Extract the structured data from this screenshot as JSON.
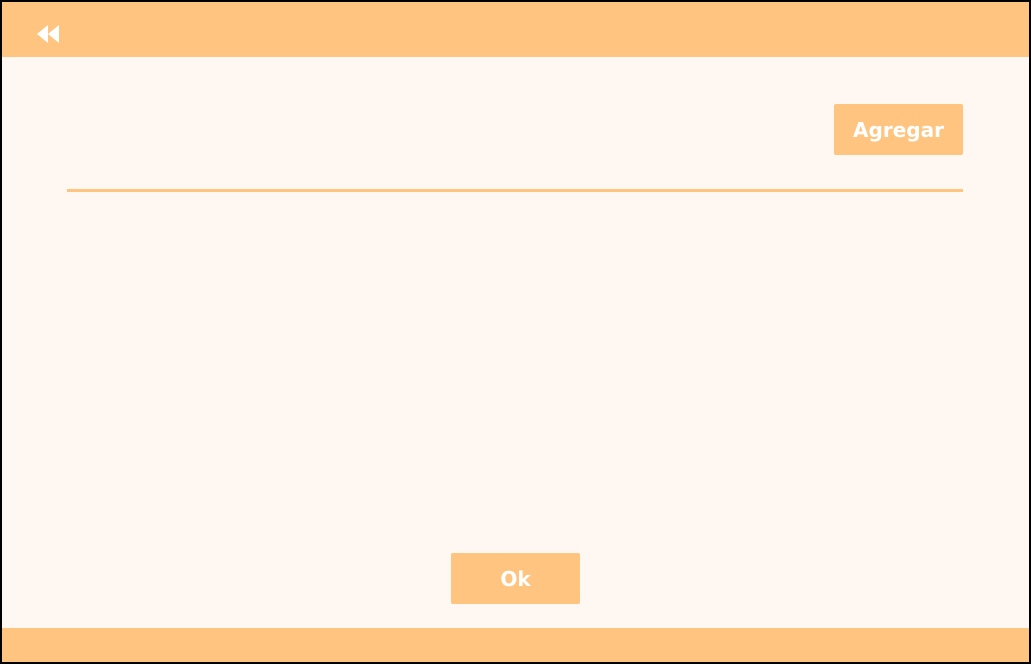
{
  "header": {
    "back_icon": "rewind-icon"
  },
  "main": {
    "add_button_label": "Agregar",
    "ok_button_label": "Ok"
  },
  "colors": {
    "accent": "#ffc580",
    "background": "#fff8f2",
    "button_text": "#ffffff",
    "border": "#000000"
  }
}
